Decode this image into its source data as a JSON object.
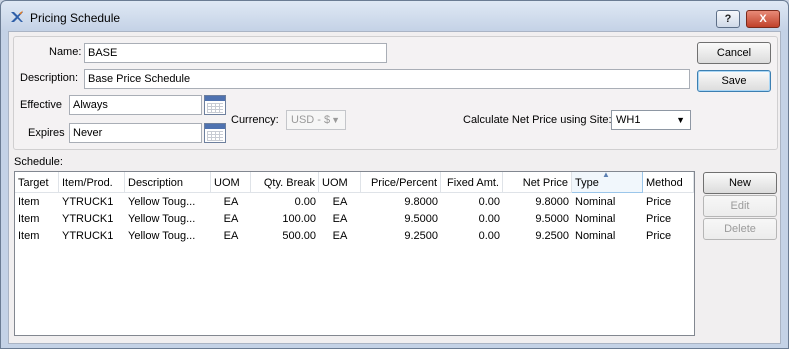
{
  "window": {
    "title": "Pricing Schedule",
    "help_label": "?",
    "close_label": "X"
  },
  "form": {
    "name_label": "Name:",
    "name_value": "BASE",
    "description_label": "Description:",
    "description_value": "Base Price Schedule",
    "effective_label": "Effective",
    "effective_value": "Always",
    "expires_label": "Expires",
    "expires_value": "Never",
    "currency_label": "Currency:",
    "currency_value": "USD - $",
    "site_label": "Calculate Net Price using Site:",
    "site_value": "WH1"
  },
  "buttons": {
    "cancel": "Cancel",
    "save": "Save",
    "new": "New",
    "edit": "Edit",
    "delete": "Delete"
  },
  "schedule": {
    "label": "Schedule:",
    "columns": [
      "Target",
      "Item/Prod.",
      "Description",
      "UOM",
      "Qty. Break",
      "UOM",
      "Price/Percent",
      "Fixed Amt.",
      "Net Price",
      "Type",
      "Method"
    ],
    "sorted_column": "Type",
    "rows": [
      [
        "Item",
        "YTRUCK1",
        "Yellow Toug...",
        "EA",
        "0.00",
        "EA",
        "9.8000",
        "0.00",
        "9.8000",
        "Nominal",
        "Price"
      ],
      [
        "Item",
        "YTRUCK1",
        "Yellow Toug...",
        "EA",
        "100.00",
        "EA",
        "9.5000",
        "0.00",
        "9.5000",
        "Nominal",
        "Price"
      ],
      [
        "Item",
        "YTRUCK1",
        "Yellow Toug...",
        "EA",
        "500.00",
        "EA",
        "9.2500",
        "0.00",
        "9.2500",
        "Nominal",
        "Price"
      ]
    ]
  },
  "icons": {
    "app": "x-logo-icon",
    "calendar": "calendar-icon",
    "dropdown": "chevron-down-icon",
    "sort": "sort-ascending-icon"
  }
}
